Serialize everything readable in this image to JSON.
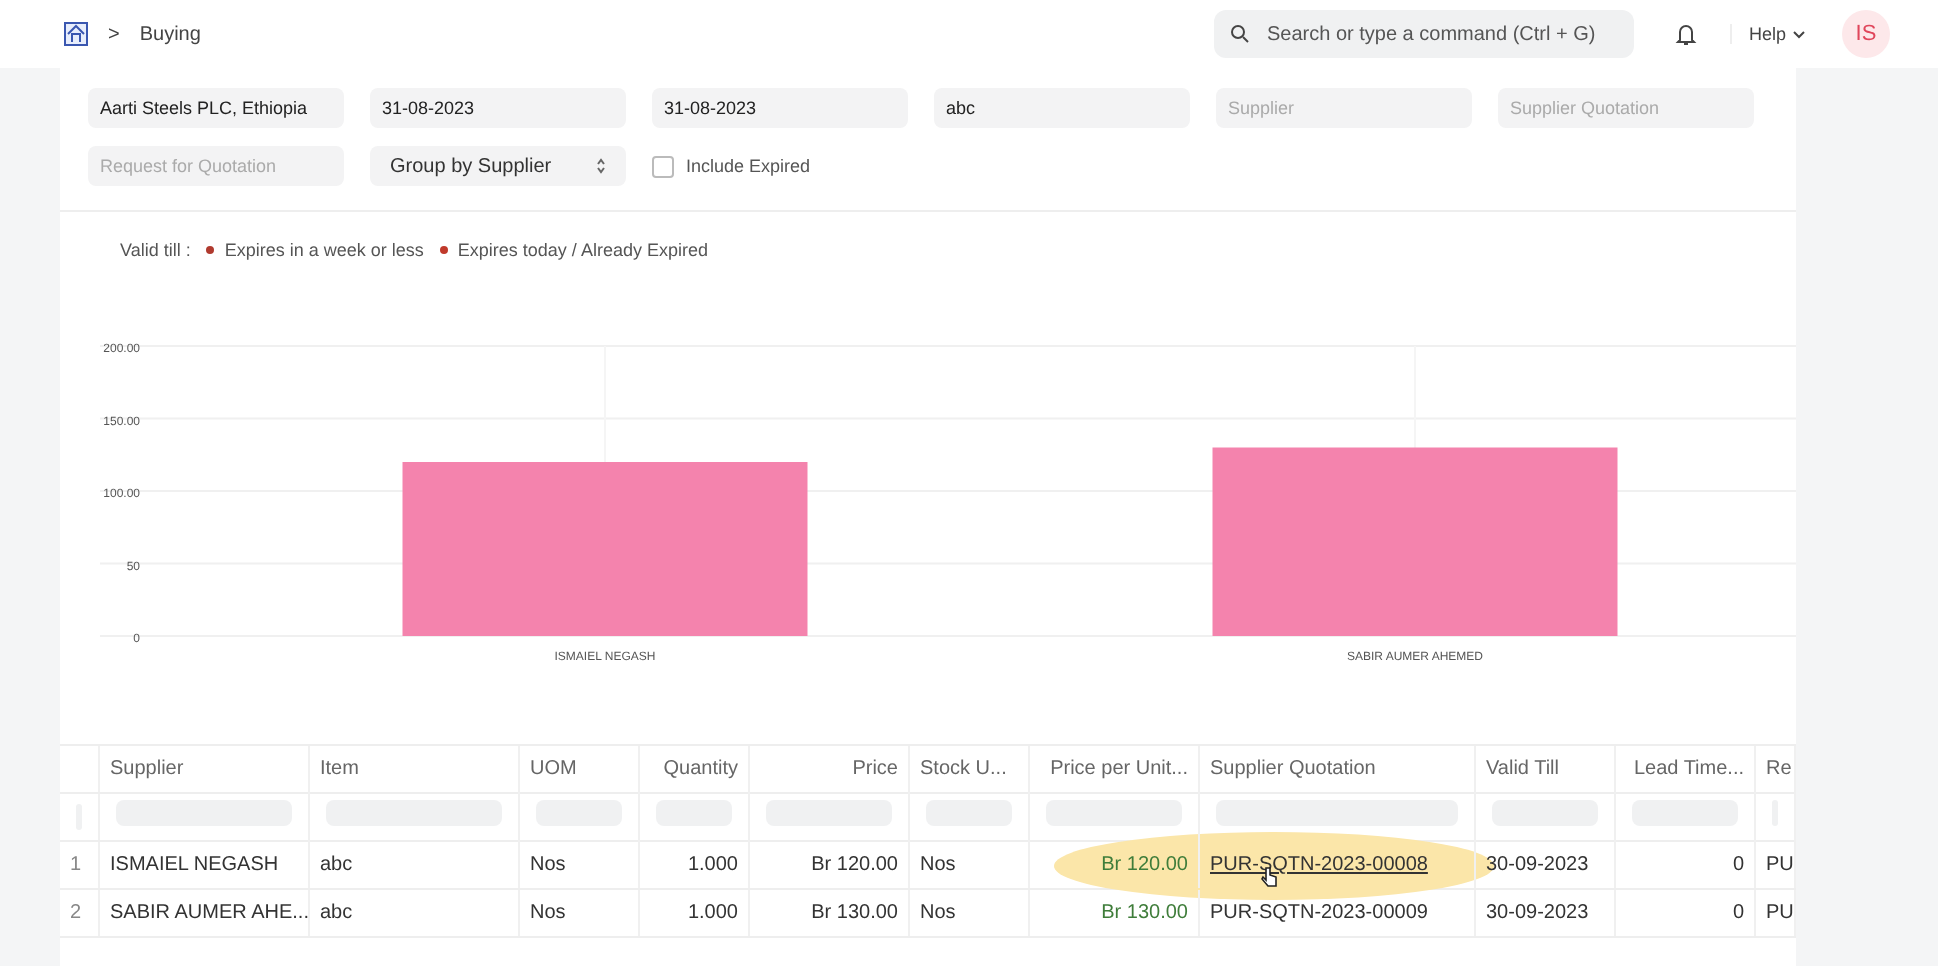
{
  "navbar": {
    "breadcrumb_separator": ">",
    "breadcrumb": "Buying",
    "search": {
      "placeholder": "Search or type a command (Ctrl + G)"
    },
    "help": "Help",
    "avatar": "IS"
  },
  "filters": [
    {
      "kind": "text",
      "value": "Aarti Steels PLC, Ethiopia"
    },
    {
      "kind": "text",
      "value": "31-08-2023"
    },
    {
      "kind": "text",
      "value": "31-08-2023"
    },
    {
      "kind": "text",
      "value": "abc"
    },
    {
      "kind": "text",
      "placeholder": "Supplier"
    },
    {
      "kind": "text",
      "placeholder": "Supplier Quotation"
    },
    {
      "kind": "text",
      "placeholder": "Request for Quotation"
    },
    {
      "kind": "select",
      "value": "Group by Supplier"
    },
    {
      "kind": "checkbox",
      "label": "Include Expired",
      "checked": false
    }
  ],
  "legend": {
    "label": "Valid till :",
    "items": [
      {
        "label": "Expires in a week or less",
        "color": "#b03a2e"
      },
      {
        "label": "Expires today / Already Expired",
        "color": "#c0392b"
      }
    ]
  },
  "chart_data": {
    "type": "bar",
    "categories": [
      "ISMAIEL NEGASH",
      "SABIR AUMER AHEMED"
    ],
    "series": [
      {
        "color": "#f483ad",
        "values": [
          120,
          130
        ]
      }
    ],
    "ylim": [
      0,
      200
    ],
    "grid": true,
    "yticks": [
      {
        "value": 0,
        "label": "0"
      },
      {
        "value": 50,
        "label": "50"
      },
      {
        "value": 100,
        "label": "100.00"
      },
      {
        "value": 150,
        "label": "150.00"
      },
      {
        "value": 200,
        "label": "200.00"
      }
    ]
  },
  "table": {
    "columns": [
      "Supplier",
      "Item",
      "UOM",
      "Quantity",
      "Price",
      "Stock U...",
      "Price per Unit...",
      "Supplier Quotation",
      "Valid Till",
      "Lead Time...",
      "Re"
    ],
    "rows": [
      {
        "index": "1",
        "cells": [
          "ISMAIEL NEGASH",
          "abc",
          "Nos",
          "1.000",
          "Br 120.00",
          "Nos",
          "Br 120.00",
          "PUR-SQTN-2023-00008",
          "30-09-2023",
          "0",
          "PU"
        ],
        "highlighted": true
      },
      {
        "index": "2",
        "cells": [
          "SABIR AUMER AHE...",
          "abc",
          "Nos",
          "1.000",
          "Br 130.00",
          "Nos",
          "Br 130.00",
          "PUR-SQTN-2023-00009",
          "30-09-2023",
          "0",
          "PU"
        ],
        "highlighted": false
      }
    ]
  }
}
